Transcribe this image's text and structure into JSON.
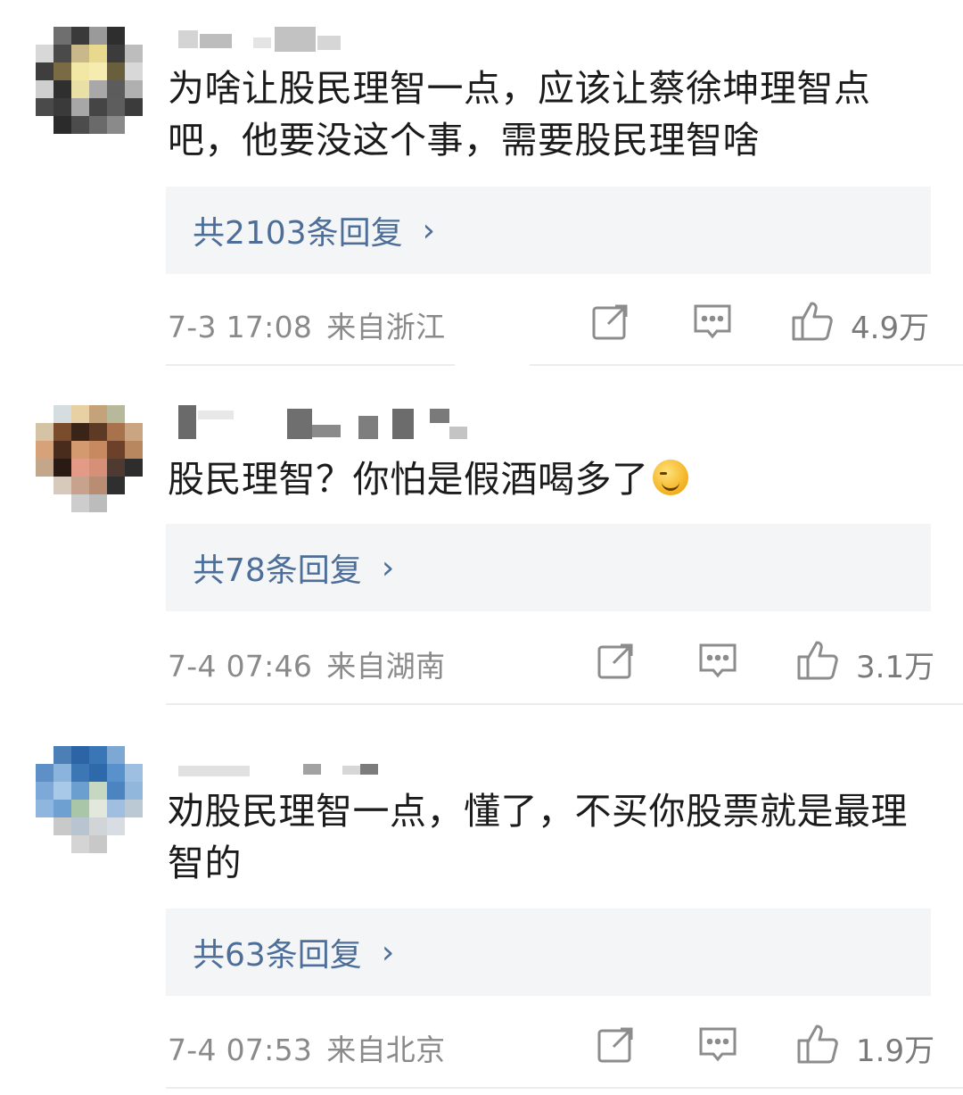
{
  "comments": [
    {
      "text": "为啥让股民理智一点，应该让蔡徐坤理智点吧，他要没这个事，需要股民理智啥",
      "replies_label": "共2103条回复",
      "timestamp": "7-3 17:08",
      "location": "来自浙江",
      "likes": "4.9万"
    },
    {
      "text": "股民理智？你怕是假酒喝多了",
      "emoji": "smirk-emoji",
      "replies_label": "共78条回复",
      "timestamp": "7-4 07:46",
      "location": "来自湖南",
      "likes": "3.1万"
    },
    {
      "text": "劝股民理智一点，懂了，不买你股票就是最理智的",
      "replies_label": "共63条回复",
      "timestamp": "7-4 07:53",
      "location": "来自北京",
      "likes": "1.9万"
    }
  ],
  "icons": {
    "share": "share-edit-icon",
    "comment": "comment-bubble-icon",
    "like": "thumbs-up-icon",
    "chevron": "chevron-right-icon"
  },
  "colors": {
    "link": "#4d6e98",
    "reply_bg": "#f4f5f7",
    "meta": "#8a8a8a",
    "icon": "#8c8c8c"
  }
}
